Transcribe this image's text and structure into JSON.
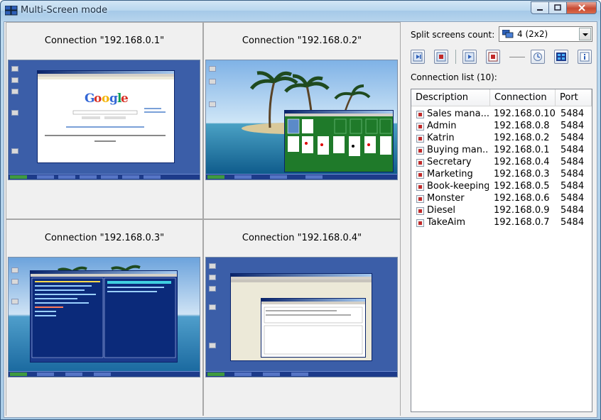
{
  "window": {
    "title": "Multi-Screen mode"
  },
  "screens": [
    {
      "title": "Connection \"192.168.0.1\""
    },
    {
      "title": "Connection \"192.168.0.2\""
    },
    {
      "title": "Connection \"192.168.0.3\""
    },
    {
      "title": "Connection \"192.168.0.4\""
    }
  ],
  "panel": {
    "split_label": "Split screens count:",
    "split_value": "4 (2x2)",
    "connection_list_label": "Connection list (10):",
    "columns": {
      "description": "Description",
      "connection": "Connection",
      "port": "Port"
    },
    "rows": [
      {
        "description": "Sales mana...",
        "connection": "192.168.0.10",
        "port": "5484"
      },
      {
        "description": "Admin",
        "connection": "192.168.0.8",
        "port": "5484"
      },
      {
        "description": "Katrin",
        "connection": "192.168.0.2",
        "port": "5484"
      },
      {
        "description": "Buying man...",
        "connection": "192.168.0.1",
        "port": "5484"
      },
      {
        "description": "Secretary",
        "connection": "192.168.0.4",
        "port": "5484"
      },
      {
        "description": "Marketing",
        "connection": "192.168.0.3",
        "port": "5484"
      },
      {
        "description": "Book-keeping",
        "connection": "192.168.0.5",
        "port": "5484"
      },
      {
        "description": "Monster",
        "connection": "192.168.0.6",
        "port": "5484"
      },
      {
        "description": "Diesel",
        "connection": "192.168.0.9",
        "port": "5484"
      },
      {
        "description": "TakeAim",
        "connection": "192.168.0.7",
        "port": "5484"
      }
    ]
  },
  "colors": {
    "desktop": "#3a5a9c",
    "accent": "#0a246a",
    "stop": "#c12a2a"
  }
}
